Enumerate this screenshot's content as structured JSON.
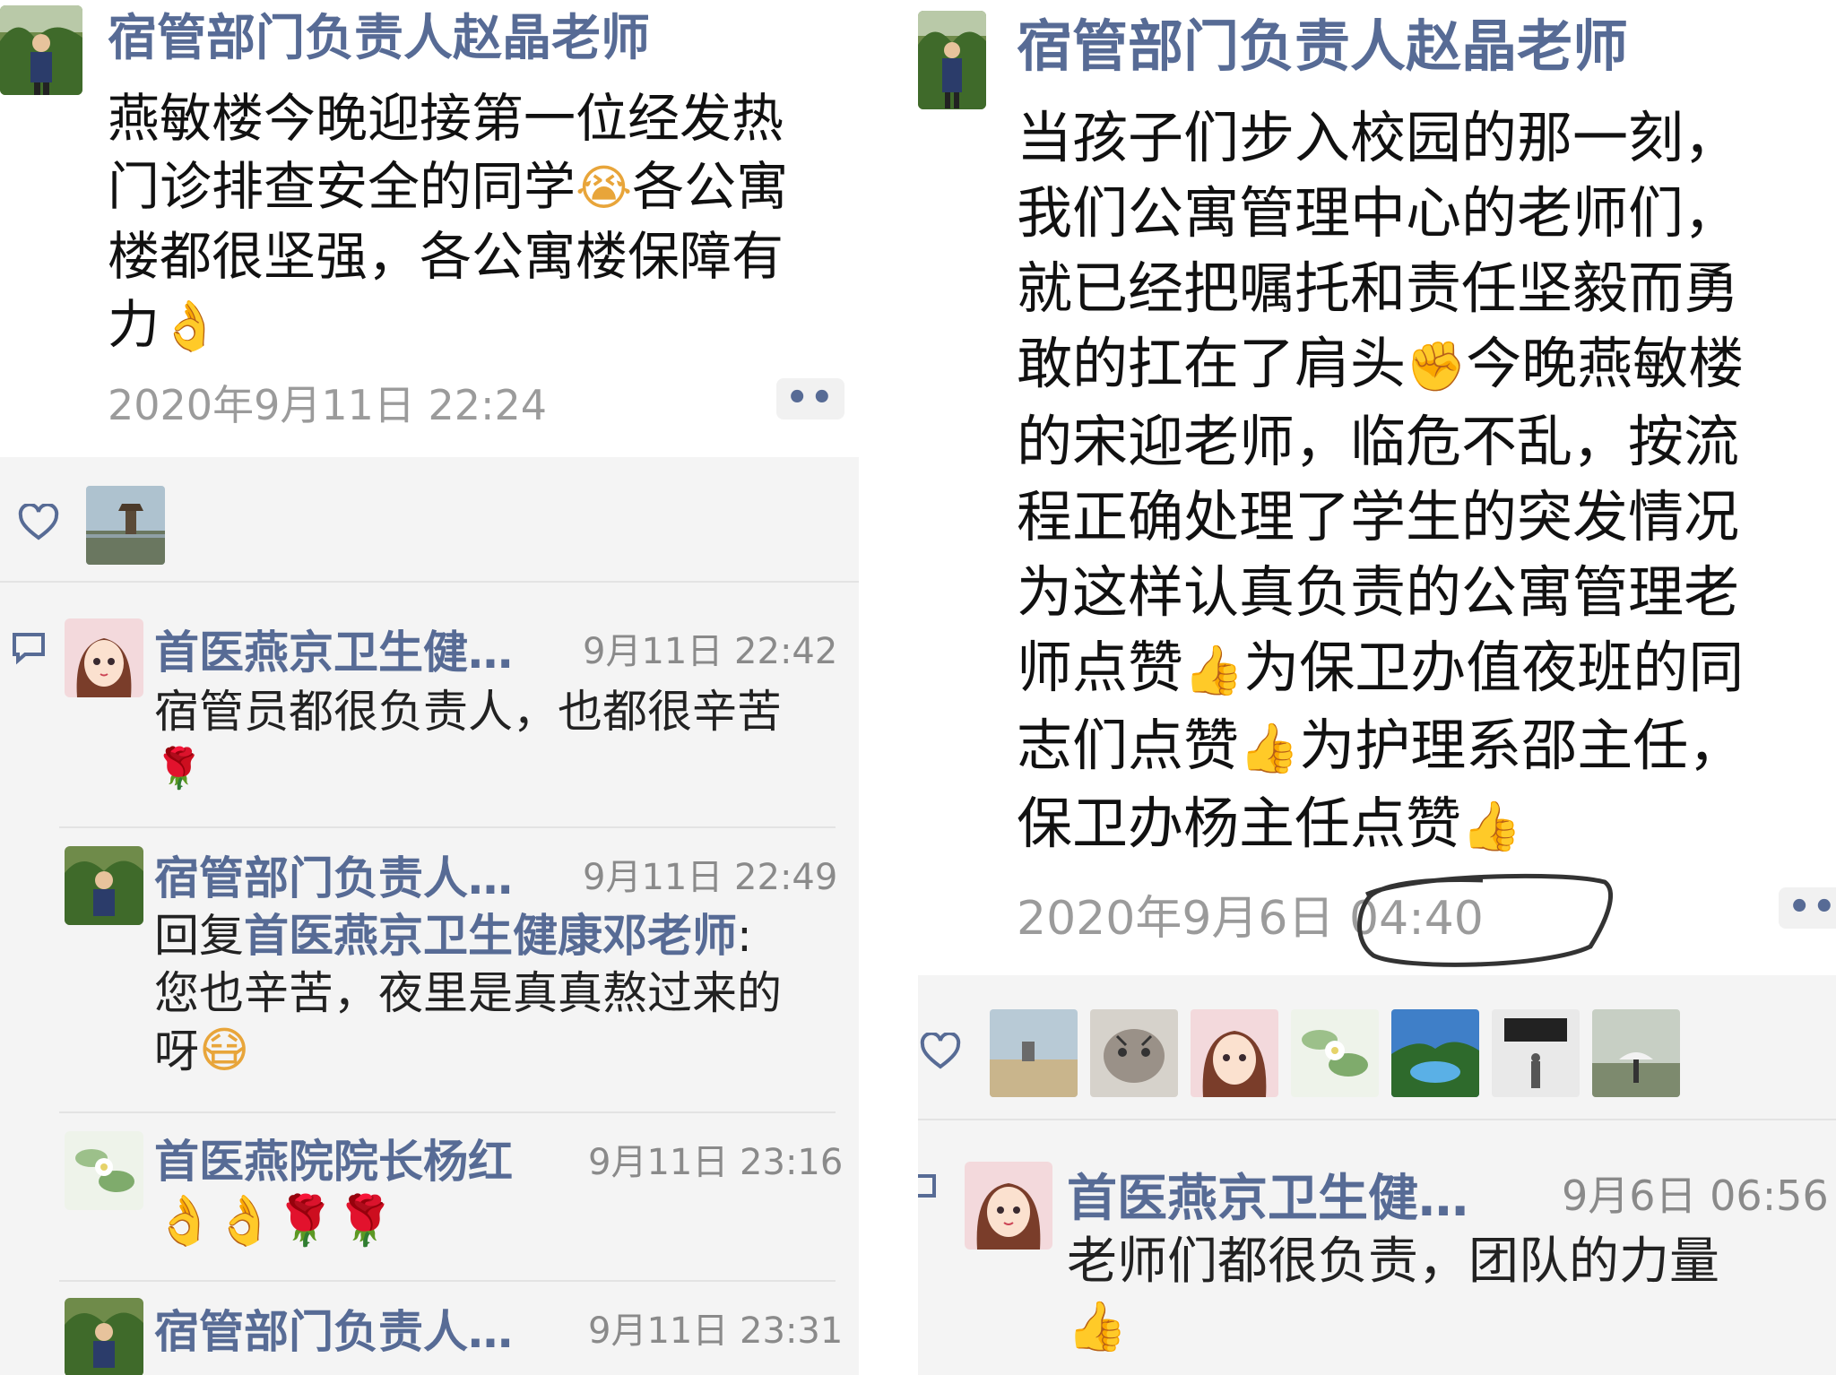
{
  "left": {
    "post": {
      "author": "宿管部门负责人赵晶老师",
      "text_lines": [
        "燕敏楼今晚迎接第一位经发热",
        "门诊排查安全的同学",
        "各公寓",
        "楼都很坚强，各公寓楼保障有",
        "力"
      ],
      "timestamp": "2020年9月11日 22:24",
      "more": "••"
    },
    "comments": [
      {
        "name": "首医燕京卫生健…",
        "time": "9月11日 22:42",
        "line1": "宿管员都很负责人，也都很辛苦",
        "emoji_line": "🌹"
      },
      {
        "name": "宿管部门负责人…",
        "time": "9月11日 22:49",
        "reply_prefix": "回复",
        "reply_target": "首医燕京卫生健康邓老师",
        "reply_colon": ":",
        "line2": "您也辛苦，夜里是真真熬过来的",
        "line3": "呀"
      },
      {
        "name": "首医燕院院长杨红",
        "time": "9月11日 23:16",
        "emoji_line": "👌👌🌹🌹"
      },
      {
        "name": "宿管部门负责人…",
        "time": "9月11日 23:31"
      }
    ]
  },
  "right": {
    "post": {
      "author": "宿管部门负责人赵晶老师",
      "text_lines": [
        "当孩子们步入校园的那一刻，",
        "我们公寓管理中心的老师们，",
        "就已经把嘱托和责任坚毅而勇",
        "敢的扛在了肩头",
        "今晚燕敏楼",
        "的宋迎老师，临危不乱，按流",
        "程正确处理了学生的突发情况",
        "为这样认真负责的公寓管理老",
        "师点赞",
        "为保卫办值夜班的同",
        "志们点赞",
        "为护理系邵主任，",
        "保卫办杨主任点赞"
      ],
      "timestamp": "2020年9月6日 04:40",
      "more": "••"
    },
    "comments": [
      {
        "name": "首医燕京卫生健…",
        "time": "9月6日 06:56",
        "line1": "老师们都很负责，团队的力量"
      }
    ]
  }
}
